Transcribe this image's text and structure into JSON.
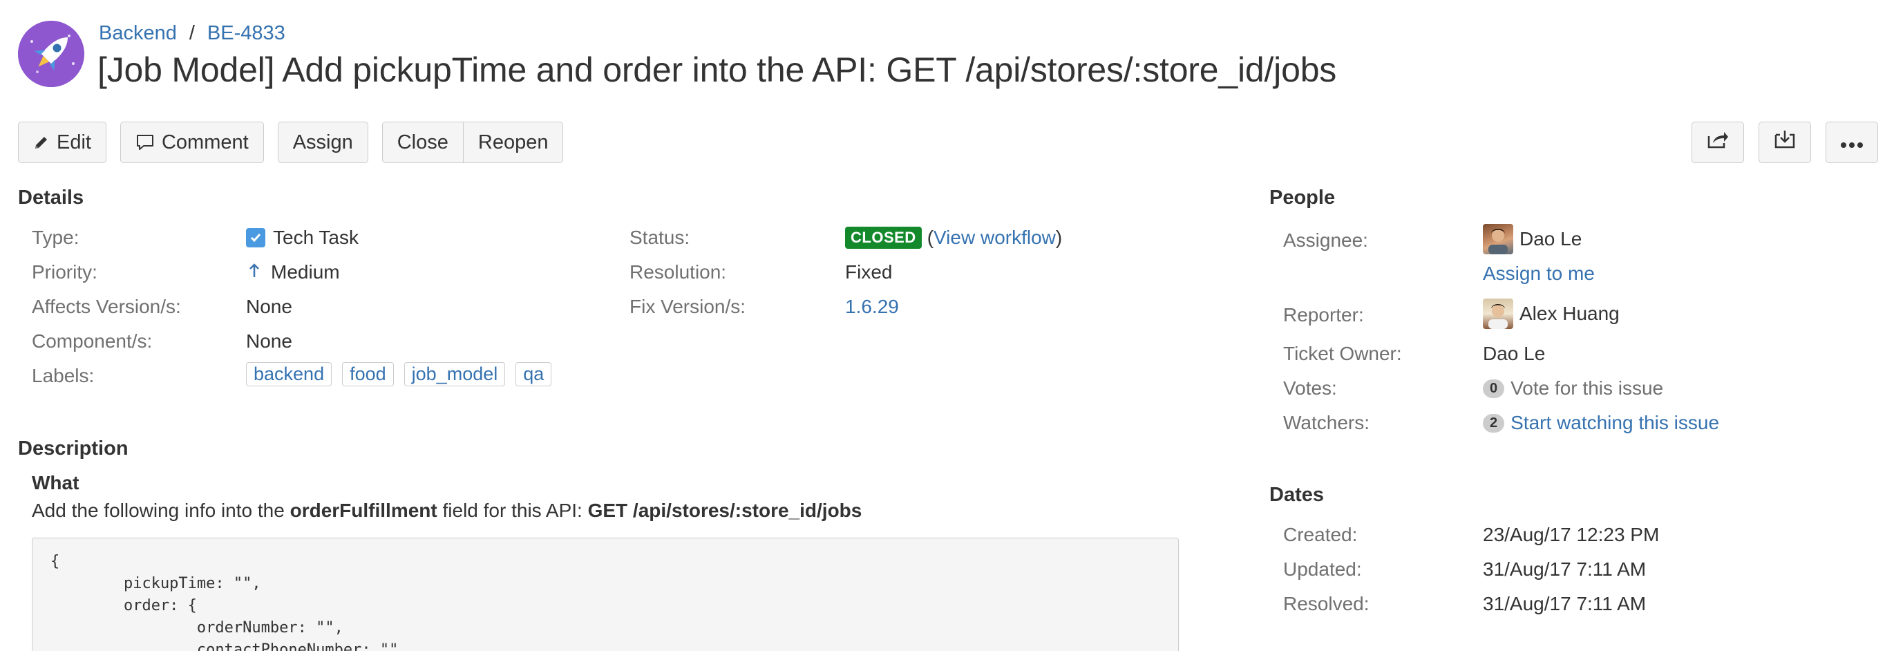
{
  "project": {
    "name": "Backend",
    "icon": "rocket-icon"
  },
  "issue": {
    "key": "BE-4833",
    "title": "[Job Model] Add pickupTime and order into the API: GET /api/stores/:store_id/jobs"
  },
  "toolbar": {
    "edit": "Edit",
    "comment": "Comment",
    "assign": "Assign",
    "close": "Close",
    "reopen": "Reopen",
    "share_icon": "share-icon",
    "export_icon": "export-icon",
    "more_icon": "more-icon"
  },
  "details": {
    "heading": "Details",
    "type": {
      "label": "Type:",
      "value": "Tech Task",
      "icon": "checkbox-icon"
    },
    "priority": {
      "label": "Priority:",
      "value": "Medium",
      "icon": "arrow-up-icon"
    },
    "affects_versions": {
      "label": "Affects Version/s:",
      "value": "None"
    },
    "components": {
      "label": "Component/s:",
      "value": "None"
    },
    "labels": {
      "label": "Labels:",
      "values": [
        "backend",
        "food",
        "job_model",
        "qa"
      ]
    },
    "status": {
      "label": "Status:",
      "value": "CLOSED",
      "color": "#14892c",
      "workflow_open": "(",
      "workflow_link": "View workflow",
      "workflow_close": ")"
    },
    "resolution": {
      "label": "Resolution:",
      "value": "Fixed"
    },
    "fix_versions": {
      "label": "Fix Version/s:",
      "value": "1.6.29"
    }
  },
  "description": {
    "heading": "Description",
    "subheading": "What",
    "text_1": "Add the following info into the ",
    "text_bold_1": "orderFulfillment",
    "text_2": " field for this API: ",
    "text_bold_2": "GET /api/stores/:store_id/jobs",
    "code": "{\n        pickupTime: \"\",\n        order: {\n                orderNumber: \"\",\n                contactPhoneNumber: \"\""
  },
  "people": {
    "heading": "People",
    "assignee": {
      "label": "Assignee:",
      "value": "Dao Le",
      "action": "Assign to me"
    },
    "reporter": {
      "label": "Reporter:",
      "value": "Alex Huang"
    },
    "ticket_owner": {
      "label": "Ticket Owner:",
      "value": "Dao Le"
    },
    "votes": {
      "label": "Votes:",
      "count": "0",
      "action": "Vote for this issue"
    },
    "watchers": {
      "label": "Watchers:",
      "count": "2",
      "action": "Start watching this issue"
    }
  },
  "dates": {
    "heading": "Dates",
    "created": {
      "label": "Created:",
      "value": "23/Aug/17 12:23 PM"
    },
    "updated": {
      "label": "Updated:",
      "value": "31/Aug/17 7:11 AM"
    },
    "resolved": {
      "label": "Resolved:",
      "value": "31/Aug/17 7:11 AM"
    }
  },
  "colors": {
    "link": "#3572b0",
    "project_avatar": "#8e57d0",
    "closed": "#14892c"
  }
}
